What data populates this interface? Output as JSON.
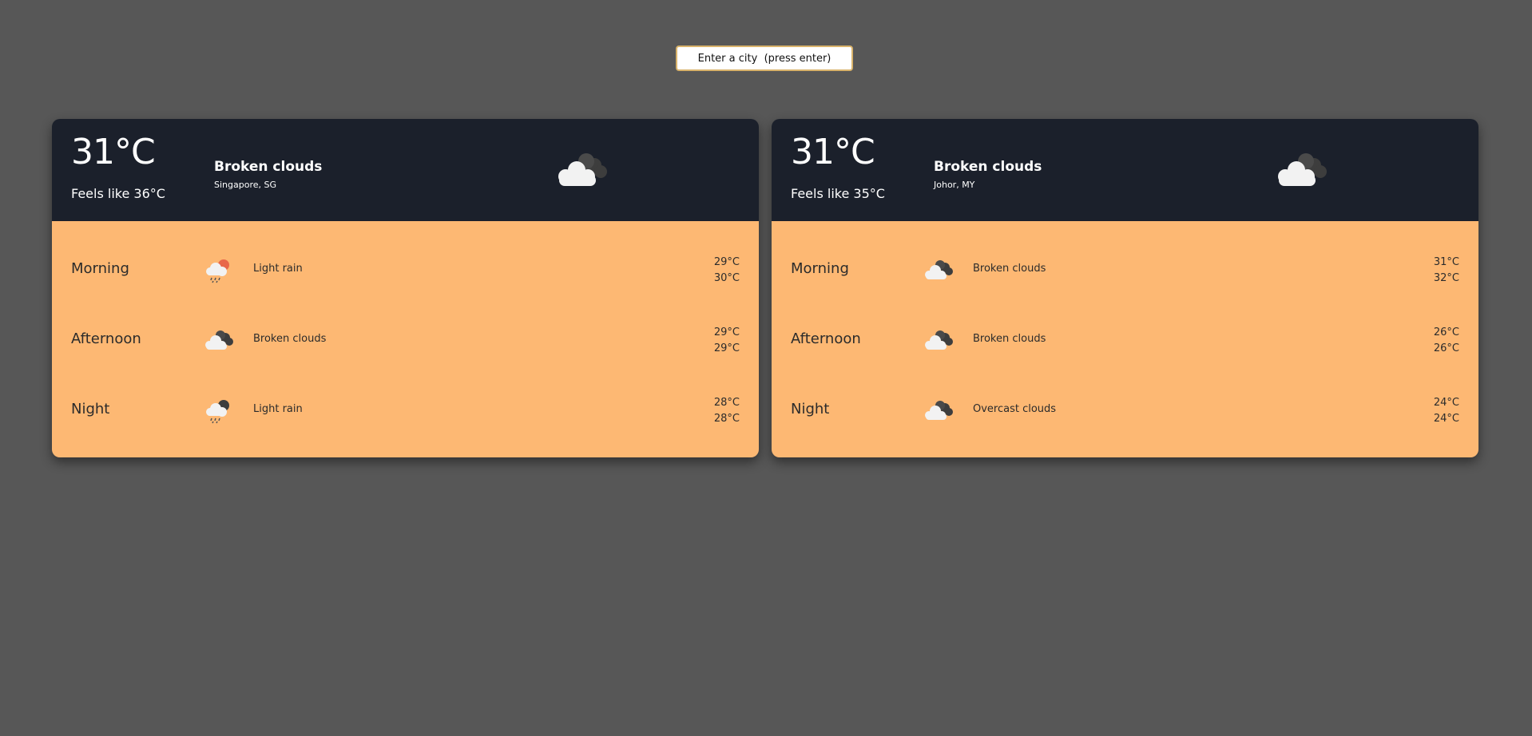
{
  "search": {
    "placeholder": "Enter a city  (press enter)"
  },
  "cards": [
    {
      "temp": "31°C",
      "feels_like": "Feels like 36°C",
      "condition": "Broken clouds",
      "location": "Singapore, SG",
      "icon": "broken-clouds-icon",
      "forecast": [
        {
          "period": "Morning",
          "icon": "light-rain-day-icon",
          "desc": "Light rain",
          "high": "29°C",
          "low": "30°C"
        },
        {
          "period": "Afternoon",
          "icon": "broken-clouds-icon",
          "desc": "Broken clouds",
          "high": "29°C",
          "low": "29°C"
        },
        {
          "period": "Night",
          "icon": "light-rain-night-icon",
          "desc": "Light rain",
          "high": "28°C",
          "low": "28°C"
        }
      ]
    },
    {
      "temp": "31°C",
      "feels_like": "Feels like 35°C",
      "condition": "Broken clouds",
      "location": "Johor, MY",
      "icon": "broken-clouds-icon",
      "forecast": [
        {
          "period": "Morning",
          "icon": "broken-clouds-icon",
          "desc": "Broken clouds",
          "high": "31°C",
          "low": "32°C"
        },
        {
          "period": "Afternoon",
          "icon": "broken-clouds-icon",
          "desc": "Broken clouds",
          "high": "26°C",
          "low": "26°C"
        },
        {
          "period": "Night",
          "icon": "overcast-clouds-icon",
          "desc": "Overcast clouds",
          "high": "24°C",
          "low": "24°C"
        }
      ]
    }
  ],
  "colors": {
    "background": "#575757",
    "card_top": "#1b202b",
    "card_bottom": "#fdb873",
    "input_border": "#d9b36b"
  }
}
